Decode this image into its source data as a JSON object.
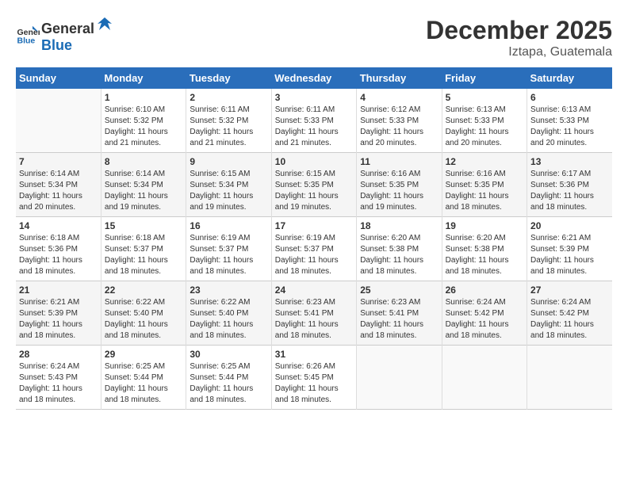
{
  "header": {
    "logo_general": "General",
    "logo_blue": "Blue",
    "month_year": "December 2025",
    "location": "Iztapa, Guatemala"
  },
  "days_of_week": [
    "Sunday",
    "Monday",
    "Tuesday",
    "Wednesday",
    "Thursday",
    "Friday",
    "Saturday"
  ],
  "weeks": [
    [
      {
        "day": "",
        "info": ""
      },
      {
        "day": "1",
        "info": "Sunrise: 6:10 AM\nSunset: 5:32 PM\nDaylight: 11 hours\nand 21 minutes."
      },
      {
        "day": "2",
        "info": "Sunrise: 6:11 AM\nSunset: 5:32 PM\nDaylight: 11 hours\nand 21 minutes."
      },
      {
        "day": "3",
        "info": "Sunrise: 6:11 AM\nSunset: 5:33 PM\nDaylight: 11 hours\nand 21 minutes."
      },
      {
        "day": "4",
        "info": "Sunrise: 6:12 AM\nSunset: 5:33 PM\nDaylight: 11 hours\nand 20 minutes."
      },
      {
        "day": "5",
        "info": "Sunrise: 6:13 AM\nSunset: 5:33 PM\nDaylight: 11 hours\nand 20 minutes."
      },
      {
        "day": "6",
        "info": "Sunrise: 6:13 AM\nSunset: 5:33 PM\nDaylight: 11 hours\nand 20 minutes."
      }
    ],
    [
      {
        "day": "7",
        "info": "Sunrise: 6:14 AM\nSunset: 5:34 PM\nDaylight: 11 hours\nand 20 minutes."
      },
      {
        "day": "8",
        "info": "Sunrise: 6:14 AM\nSunset: 5:34 PM\nDaylight: 11 hours\nand 19 minutes."
      },
      {
        "day": "9",
        "info": "Sunrise: 6:15 AM\nSunset: 5:34 PM\nDaylight: 11 hours\nand 19 minutes."
      },
      {
        "day": "10",
        "info": "Sunrise: 6:15 AM\nSunset: 5:35 PM\nDaylight: 11 hours\nand 19 minutes."
      },
      {
        "day": "11",
        "info": "Sunrise: 6:16 AM\nSunset: 5:35 PM\nDaylight: 11 hours\nand 19 minutes."
      },
      {
        "day": "12",
        "info": "Sunrise: 6:16 AM\nSunset: 5:35 PM\nDaylight: 11 hours\nand 18 minutes."
      },
      {
        "day": "13",
        "info": "Sunrise: 6:17 AM\nSunset: 5:36 PM\nDaylight: 11 hours\nand 18 minutes."
      }
    ],
    [
      {
        "day": "14",
        "info": "Sunrise: 6:18 AM\nSunset: 5:36 PM\nDaylight: 11 hours\nand 18 minutes."
      },
      {
        "day": "15",
        "info": "Sunrise: 6:18 AM\nSunset: 5:37 PM\nDaylight: 11 hours\nand 18 minutes."
      },
      {
        "day": "16",
        "info": "Sunrise: 6:19 AM\nSunset: 5:37 PM\nDaylight: 11 hours\nand 18 minutes."
      },
      {
        "day": "17",
        "info": "Sunrise: 6:19 AM\nSunset: 5:37 PM\nDaylight: 11 hours\nand 18 minutes."
      },
      {
        "day": "18",
        "info": "Sunrise: 6:20 AM\nSunset: 5:38 PM\nDaylight: 11 hours\nand 18 minutes."
      },
      {
        "day": "19",
        "info": "Sunrise: 6:20 AM\nSunset: 5:38 PM\nDaylight: 11 hours\nand 18 minutes."
      },
      {
        "day": "20",
        "info": "Sunrise: 6:21 AM\nSunset: 5:39 PM\nDaylight: 11 hours\nand 18 minutes."
      }
    ],
    [
      {
        "day": "21",
        "info": "Sunrise: 6:21 AM\nSunset: 5:39 PM\nDaylight: 11 hours\nand 18 minutes."
      },
      {
        "day": "22",
        "info": "Sunrise: 6:22 AM\nSunset: 5:40 PM\nDaylight: 11 hours\nand 18 minutes."
      },
      {
        "day": "23",
        "info": "Sunrise: 6:22 AM\nSunset: 5:40 PM\nDaylight: 11 hours\nand 18 minutes."
      },
      {
        "day": "24",
        "info": "Sunrise: 6:23 AM\nSunset: 5:41 PM\nDaylight: 11 hours\nand 18 minutes."
      },
      {
        "day": "25",
        "info": "Sunrise: 6:23 AM\nSunset: 5:41 PM\nDaylight: 11 hours\nand 18 minutes."
      },
      {
        "day": "26",
        "info": "Sunrise: 6:24 AM\nSunset: 5:42 PM\nDaylight: 11 hours\nand 18 minutes."
      },
      {
        "day": "27",
        "info": "Sunrise: 6:24 AM\nSunset: 5:42 PM\nDaylight: 11 hours\nand 18 minutes."
      }
    ],
    [
      {
        "day": "28",
        "info": "Sunrise: 6:24 AM\nSunset: 5:43 PM\nDaylight: 11 hours\nand 18 minutes."
      },
      {
        "day": "29",
        "info": "Sunrise: 6:25 AM\nSunset: 5:44 PM\nDaylight: 11 hours\nand 18 minutes."
      },
      {
        "day": "30",
        "info": "Sunrise: 6:25 AM\nSunset: 5:44 PM\nDaylight: 11 hours\nand 18 minutes."
      },
      {
        "day": "31",
        "info": "Sunrise: 6:26 AM\nSunset: 5:45 PM\nDaylight: 11 hours\nand 18 minutes."
      },
      {
        "day": "",
        "info": ""
      },
      {
        "day": "",
        "info": ""
      },
      {
        "day": "",
        "info": ""
      }
    ]
  ]
}
